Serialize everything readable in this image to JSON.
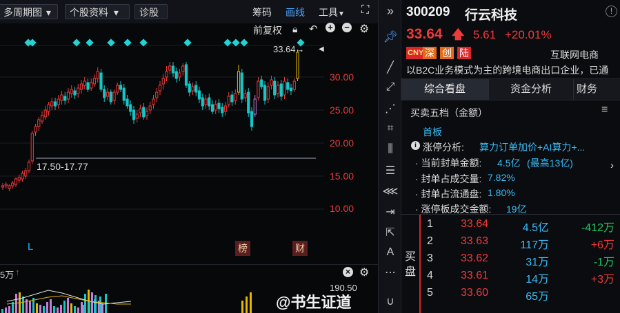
{
  "toolbar": {
    "period_label": "多周期图",
    "period_chevron": "⌄",
    "stock_info_label": "个股资料",
    "diagnose_label": "诊股",
    "chips_label": "筹码",
    "draw_label": "画线",
    "tools_label": "工具",
    "expand_icon": "⛶",
    "collapse_icon": "»"
  },
  "chart": {
    "adjust_label": "前复权",
    "price_marker": "33.64→",
    "range_label": "17.50-17.77",
    "y_ticks": [
      "30.00",
      "25.00",
      "20.00",
      "15.00",
      "10.00"
    ],
    "marker_L": "L",
    "marker_bang": "榜",
    "marker_cai": "财",
    "vol_label": "5万",
    "vol_top": "190.50",
    "watermark": "@书生证道",
    "colors": {
      "up": "#f03a3a",
      "down": "#14c6c6",
      "gold": "#e6b800",
      "diamond": "#22d3d3"
    }
  },
  "panel": {
    "code": "300209",
    "name": "行云科技",
    "price": "33.64",
    "change": "5.61",
    "change_pct": "+20.01%",
    "badges": [
      "CNY",
      "深",
      "创",
      "陆"
    ],
    "industry": "互联网电商",
    "desc": "以B2C业务模式为主的跨境电商出口企业，已通",
    "tabs": [
      "综合看盘",
      "资金分析",
      "财务"
    ],
    "section_title": "买卖五档（金额）",
    "board": "首板",
    "analysis_label": "涨停分析:",
    "analysis_value": "算力订单加价+AI算力+...",
    "lines": [
      {
        "label": "· 当前封单金额:",
        "value": "4.5亿",
        "extra": "(最高13亿)"
      },
      {
        "label": "· 封单占成交量:",
        "value": "7.82%"
      },
      {
        "label": "· 封单占流通盘:",
        "value": "1.80%"
      },
      {
        "label": "· 涨停板成交金额:",
        "value": "19亿"
      }
    ],
    "buy_label_1": "买",
    "buy_label_2": "盘",
    "book": [
      {
        "n": "1",
        "price": "33.64",
        "amt": "4.5亿",
        "chg": "-412万"
      },
      {
        "n": "2",
        "price": "33.63",
        "amt": "117万",
        "chg": "+6万"
      },
      {
        "n": "3",
        "price": "33.62",
        "amt": "31万",
        "chg": "-1万"
      },
      {
        "n": "4",
        "price": "33.61",
        "amt": "14万",
        "chg": "+3万"
      },
      {
        "n": "5",
        "price": "33.60",
        "amt": "65万",
        "chg": ""
      }
    ]
  }
}
